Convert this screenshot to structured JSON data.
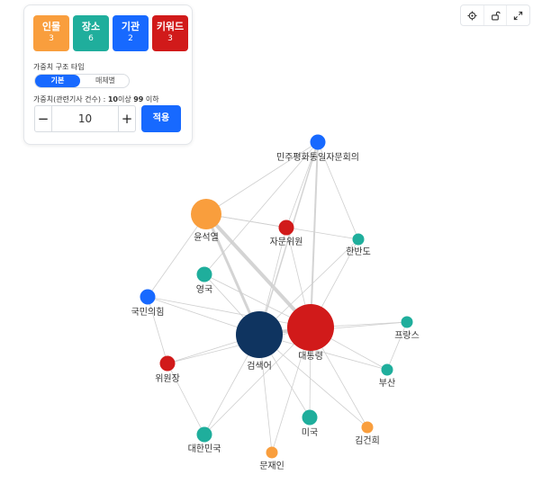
{
  "panel": {
    "categories": [
      {
        "label": "인물",
        "count": "3",
        "color": "#f99e3d"
      },
      {
        "label": "장소",
        "count": "6",
        "color": "#1fae9c"
      },
      {
        "label": "기관",
        "count": "2",
        "color": "#1769ff"
      },
      {
        "label": "키워드",
        "count": "3",
        "color": "#d11a1a"
      }
    ],
    "structure_label": "가중치 구조 타입",
    "structure_options": [
      "기본",
      "매체별"
    ],
    "weight_prefix": "가중치(관련기사 건수) : ",
    "weight_min": "10",
    "weight_mid": "이상 ",
    "weight_max": "99",
    "weight_suffix": " 이하",
    "stepper_value": "10",
    "minus_label": "−",
    "plus_label": "+",
    "apply_label": "적용"
  },
  "toolbar": {
    "icons": [
      "crosshair-icon",
      "unlock-icon",
      "expand-icon"
    ]
  },
  "graph": {
    "nodes": [
      {
        "id": "minju",
        "label": "민주평화통일자문회의",
        "type": "기관",
        "color": "#1769ff"
      },
      {
        "id": "yoon",
        "label": "윤석열",
        "type": "인물",
        "color": "#f99e3d"
      },
      {
        "id": "jamun",
        "label": "자문위원",
        "type": "키워드",
        "color": "#d11a1a"
      },
      {
        "id": "hanbando",
        "label": "한반도",
        "type": "장소",
        "color": "#1fae9c"
      },
      {
        "id": "uk",
        "label": "영국",
        "type": "장소",
        "color": "#1fae9c"
      },
      {
        "id": "kukmin",
        "label": "국민의힘",
        "type": "기관",
        "color": "#1769ff"
      },
      {
        "id": "search",
        "label": "검색어",
        "type": "검색어",
        "color": "#0f3460"
      },
      {
        "id": "pres",
        "label": "대통령",
        "type": "키워드",
        "color": "#d11a1a"
      },
      {
        "id": "france",
        "label": "프랑스",
        "type": "장소",
        "color": "#1fae9c"
      },
      {
        "id": "busan",
        "label": "부산",
        "type": "장소",
        "color": "#1fae9c"
      },
      {
        "id": "wiwon",
        "label": "위원장",
        "type": "키워드",
        "color": "#d11a1a"
      },
      {
        "id": "korea",
        "label": "대한민국",
        "type": "장소",
        "color": "#1fae9c"
      },
      {
        "id": "usa",
        "label": "미국",
        "type": "장소",
        "color": "#1fae9c"
      },
      {
        "id": "kimgh",
        "label": "김건희",
        "type": "인물",
        "color": "#f99e3d"
      },
      {
        "id": "moon",
        "label": "문재인",
        "type": "인물",
        "color": "#f99e3d"
      }
    ],
    "edges": [
      {
        "source": "yoon",
        "target": "pres"
      },
      {
        "source": "yoon",
        "target": "search"
      },
      {
        "source": "search",
        "target": "pres"
      },
      {
        "source": "yoon",
        "target": "minju"
      },
      {
        "source": "yoon",
        "target": "jamun"
      },
      {
        "source": "yoon",
        "target": "kukmin"
      },
      {
        "source": "yoon",
        "target": "hanbando"
      },
      {
        "source": "minju",
        "target": "jamun"
      },
      {
        "source": "minju",
        "target": "pres"
      },
      {
        "source": "minju",
        "target": "search"
      },
      {
        "source": "minju",
        "target": "hanbando"
      },
      {
        "source": "minju",
        "target": "uk"
      },
      {
        "source": "jamun",
        "target": "pres"
      },
      {
        "source": "jamun",
        "target": "search"
      },
      {
        "source": "hanbando",
        "target": "pres"
      },
      {
        "source": "hanbando",
        "target": "search"
      },
      {
        "source": "uk",
        "target": "pres"
      },
      {
        "source": "uk",
        "target": "search"
      },
      {
        "source": "kukmin",
        "target": "search"
      },
      {
        "source": "kukmin",
        "target": "pres"
      },
      {
        "source": "kukmin",
        "target": "wiwon"
      },
      {
        "source": "search",
        "target": "wiwon"
      },
      {
        "source": "search",
        "target": "korea"
      },
      {
        "source": "search",
        "target": "usa"
      },
      {
        "source": "search",
        "target": "moon"
      },
      {
        "source": "search",
        "target": "france"
      },
      {
        "source": "search",
        "target": "busan"
      },
      {
        "source": "search",
        "target": "kimgh"
      },
      {
        "source": "pres",
        "target": "france"
      },
      {
        "source": "pres",
        "target": "busan"
      },
      {
        "source": "pres",
        "target": "usa"
      },
      {
        "source": "pres",
        "target": "kimgh"
      },
      {
        "source": "pres",
        "target": "korea"
      },
      {
        "source": "pres",
        "target": "moon"
      },
      {
        "source": "pres",
        "target": "wiwon"
      },
      {
        "source": "wiwon",
        "target": "korea"
      },
      {
        "source": "france",
        "target": "busan"
      }
    ]
  }
}
